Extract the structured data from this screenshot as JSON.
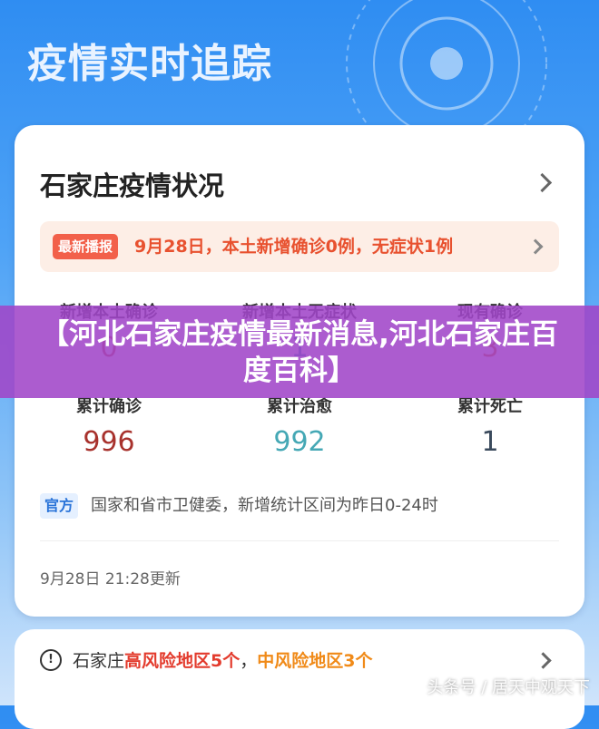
{
  "header": {
    "title": "疫情实时追踪"
  },
  "card": {
    "title": "石家庄疫情状况",
    "news": {
      "tag": "最新播报",
      "text": "9月28日，本土新增确诊0例，无症状1例"
    },
    "stats_row1": [
      {
        "label": "新增本土确诊",
        "value": "0",
        "color": "#c0392b"
      },
      {
        "label": "新增本土无症状",
        "value": "1",
        "color": "#2e8bb0"
      },
      {
        "label": "现有确诊",
        "value": "3",
        "color": "#d35400"
      }
    ],
    "stats_row2": [
      {
        "label": "累计确诊",
        "value": "996",
        "color": "#a8322d"
      },
      {
        "label": "累计治愈",
        "value": "992",
        "color": "#45a8b5"
      },
      {
        "label": "累计死亡",
        "value": "1",
        "color": "#3a4a5c"
      }
    ],
    "official": {
      "tag": "官方",
      "text": "国家和省市卫健委，新增统计区间为昨日0-24时"
    },
    "update_time": "9月28日 21:28更新"
  },
  "risk": {
    "prefix": "石家庄",
    "high": "高风险地区5个",
    "sep": "，",
    "mid": "中风险地区3个"
  },
  "overlay": {
    "title": "【河北石家庄疫情最新消息,河北石家庄百度百科】"
  },
  "watermark": "头条号 / 居天中观天下",
  "colors": {
    "accent_blue": "#2f8df2",
    "overlay_purple": "#a046c8",
    "news_red": "#e8512f"
  }
}
